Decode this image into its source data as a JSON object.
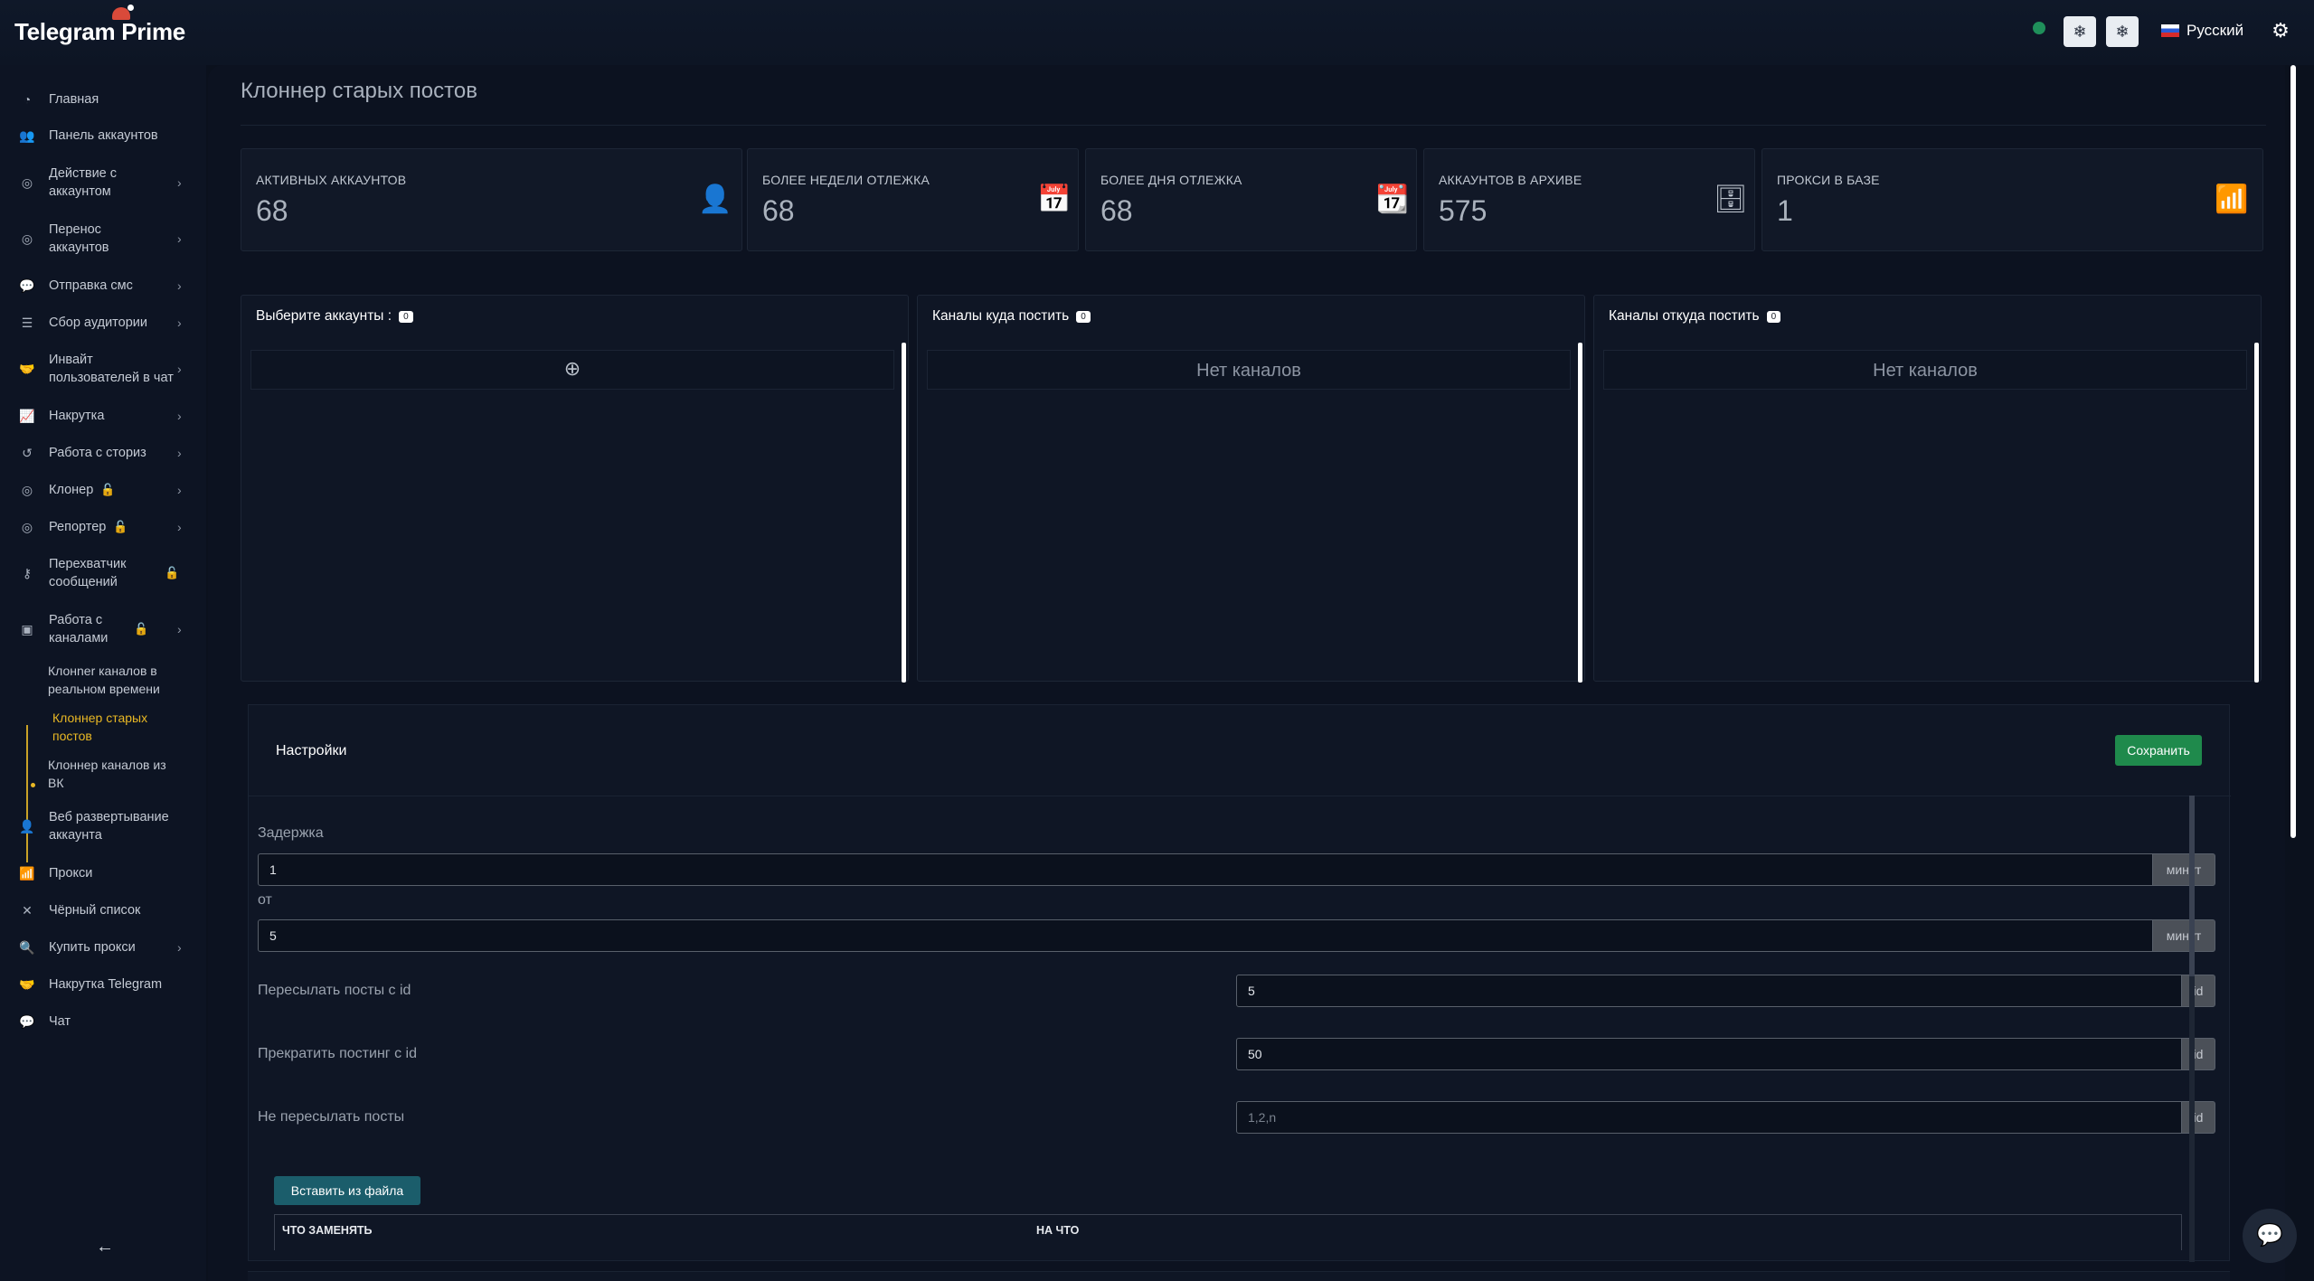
{
  "app": {
    "logo": "Telegram Prime",
    "language": "Русский",
    "theme_buttons": [
      "❄",
      "❄"
    ]
  },
  "sidebar": {
    "items": [
      {
        "label": "Главная",
        "icon": "dashboard-icon"
      },
      {
        "label": "Панель аккаунтов",
        "icon": "users-icon"
      },
      {
        "label": "Действие с аккаунтом",
        "icon": "user-circle-icon"
      },
      {
        "label": "Перенос аккаунтов",
        "icon": "transfer-icon"
      },
      {
        "label": "Отправка смс",
        "icon": "chat-icon"
      },
      {
        "label": "Сбор аудитории",
        "icon": "database-icon"
      },
      {
        "label": "Инвайт пользователей в чат",
        "icon": "handshake-icon"
      },
      {
        "label": "Накрутка",
        "icon": "chart-icon"
      },
      {
        "label": "Работа с сториз",
        "icon": "history-icon"
      },
      {
        "label": "Клонер",
        "icon": "clone-icon"
      },
      {
        "label": "Репортер",
        "icon": "report-icon"
      },
      {
        "label": "Перехватчик сообщений",
        "icon": "interceptor-icon"
      },
      {
        "label": "Работа с каналами",
        "icon": "channel-icon"
      },
      {
        "label": "Веб развертывание аккаунта",
        "icon": "web-user-icon"
      },
      {
        "label": "Прокси",
        "icon": "wifi-icon"
      },
      {
        "label": "Чёрный список",
        "icon": "close-icon"
      },
      {
        "label": "Купить прокси",
        "icon": "search-plus-icon"
      },
      {
        "label": "Накрутка Telegram",
        "icon": "handshake-icon"
      },
      {
        "label": "Чат",
        "icon": "chat-icon"
      }
    ],
    "sub_items": [
      {
        "label": "Клонner каналов в реальном времени"
      },
      {
        "label": "Клоннер старых постов"
      },
      {
        "label": "Клоннер каналов из ВК"
      }
    ]
  },
  "page": {
    "title": "Клоннер старых постов"
  },
  "stats": [
    {
      "label": "АКТИВНЫХ АККАУНТОВ",
      "value": "68",
      "icon": "user-icon"
    },
    {
      "label": "БОЛЕЕ НЕДЕЛИ ОТЛЕЖКА",
      "value": "68",
      "icon": "calendar-check-icon"
    },
    {
      "label": "БОЛЕЕ ДНЯ ОТЛЕЖКА",
      "value": "68",
      "icon": "calendar-icon"
    },
    {
      "label": "АККАУНТОВ В АРХИВЕ",
      "value": "575",
      "icon": "archive-file-icon"
    },
    {
      "label": "ПРОКСИ В БАЗЕ",
      "value": "1",
      "icon": "wifi-icon"
    }
  ],
  "panels": [
    {
      "title": "Выберите аккаунты :",
      "count": "0",
      "empty": ""
    },
    {
      "title": "Каналы куда постить",
      "count": "0",
      "empty": "Нет каналов"
    },
    {
      "title": "Каналы откуда постить",
      "count": "0",
      "empty": "Нет каналов"
    }
  ],
  "settings": {
    "title": "Настройки",
    "save_label": "Сохранить",
    "delay_label": "Задержка",
    "delay_value": "1",
    "delay_unit": "минут",
    "from_label": "от",
    "from_value": "5",
    "from_unit": "минут",
    "forward_from_label": "Пересылать посты с id",
    "forward_from_value": "5",
    "forward_from_unit": "id",
    "stop_label": "Прекратить постинг с id",
    "stop_value": "50",
    "stop_unit": "id",
    "skip_label": "Не пересылать посты",
    "skip_placeholder": "1,2,n",
    "skip_unit": "id",
    "file_button": "Вставить из файла",
    "table_headers": [
      "ЧТО ЗАМЕНЯТЬ",
      "НА ЧТО"
    ]
  }
}
